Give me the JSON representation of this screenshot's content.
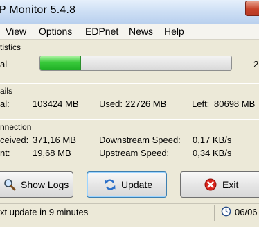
{
  "window": {
    "title": "P Monitor 5.4.8"
  },
  "menu": {
    "items": [
      "View",
      "Options",
      "EDPnet",
      "News",
      "Help"
    ]
  },
  "statistics": {
    "section_label": "tistics",
    "row_label": "al",
    "progress_fraction": 0.21,
    "right_value": "2"
  },
  "details": {
    "section_label": "ails",
    "total_label": "al:",
    "total_value": "103424 MB",
    "used_label": "Used:",
    "used_value": "22726 MB",
    "left_label": "Left:",
    "left_value": "80698 MB"
  },
  "connection": {
    "section_label": "nnection",
    "received_label": "ceived:",
    "received_value": "371,16 MB",
    "sent_label": "nt:",
    "sent_value": "19,68 MB",
    "downstream_label": "Downstream Speed:",
    "downstream_value": "0,17 KB/s",
    "upstream_label": "Upstream Speed:",
    "upstream_value": "0,34 KB/s"
  },
  "buttons": {
    "show_logs": "Show Logs",
    "update": "Update",
    "exit": "Exit"
  },
  "status": {
    "message": "xt update in 9 minutes",
    "date": "06/06"
  },
  "colors": {
    "progress_green": "#2fbf35",
    "exit_red": "#d9241c",
    "update_blue": "#2a6fc9"
  }
}
